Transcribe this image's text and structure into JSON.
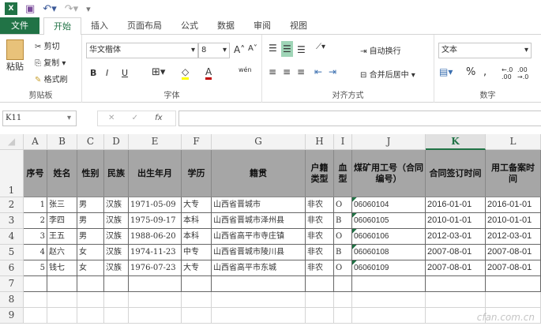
{
  "qat": {
    "icons": [
      "excel-icon",
      "save-icon",
      "undo-icon",
      "redo-icon",
      "customize-icon"
    ]
  },
  "tabs": [
    "文件",
    "开始",
    "插入",
    "页面布局",
    "公式",
    "数据",
    "审阅",
    "视图"
  ],
  "ribbon": {
    "clipboard": {
      "paste": "粘贴",
      "cut": "剪切",
      "copy": "复制",
      "format_painter": "格式刷",
      "label": "剪贴板"
    },
    "font": {
      "name": "华文楷体",
      "size": "8",
      "bold": "B",
      "italic": "I",
      "underline": "U",
      "label": "字体",
      "phonetic": "wén"
    },
    "alignment": {
      "wrap": "自动换行",
      "merge": "合并后居中",
      "label": "对齐方式"
    },
    "number": {
      "format": "文本",
      "percent": "%",
      "comma": ",",
      "label": "数字"
    }
  },
  "formula_bar": {
    "name_box": "K11",
    "formula": "",
    "fx": "fx"
  },
  "columns": [
    "A",
    "B",
    "C",
    "D",
    "E",
    "F",
    "G",
    "H",
    "I",
    "J",
    "K",
    "L"
  ],
  "selected_column": "K",
  "header_row": [
    "序号",
    "姓名",
    "性别",
    "民族",
    "出生年月",
    "学历",
    "籍贯",
    "户籍类型",
    "血型",
    "煤矿用工号（合同编号）",
    "合同签订时间",
    "用工备案时间"
  ],
  "rows": [
    [
      "1",
      "张三",
      "男",
      "汉族",
      "1971-05-09",
      "大专",
      "山西省晋城市",
      "非农",
      "O",
      "06060104",
      "2016-01-01",
      "2016-01-01"
    ],
    [
      "2",
      "李四",
      "男",
      "汉族",
      "1975-09-17",
      "本科",
      "山西省晋城市泽州县",
      "非农",
      "B",
      "06060105",
      "2010-01-01",
      "2010-01-01"
    ],
    [
      "3",
      "王五",
      "男",
      "汉族",
      "1988-06-20",
      "本科",
      "山西省高平市寺庄镇",
      "非农",
      "O",
      "06060106",
      "2012-03-01",
      "2012-03-01"
    ],
    [
      "4",
      "赵六",
      "女",
      "汉族",
      "1974-11-23",
      "中专",
      "山西省晋城市陵川县",
      "非农",
      "B",
      "06060108",
      "2007-08-01",
      "2007-08-01"
    ],
    [
      "5",
      "钱七",
      "女",
      "汉族",
      "1976-07-23",
      "大专",
      "山西省高平市东城",
      "非农",
      "O",
      "06060109",
      "2007-08-01",
      "2007-08-01"
    ]
  ],
  "row_numbers": [
    "1",
    "2",
    "3",
    "4",
    "5",
    "6",
    "7",
    "8",
    "9"
  ],
  "watermark": "cfan.com.cn"
}
